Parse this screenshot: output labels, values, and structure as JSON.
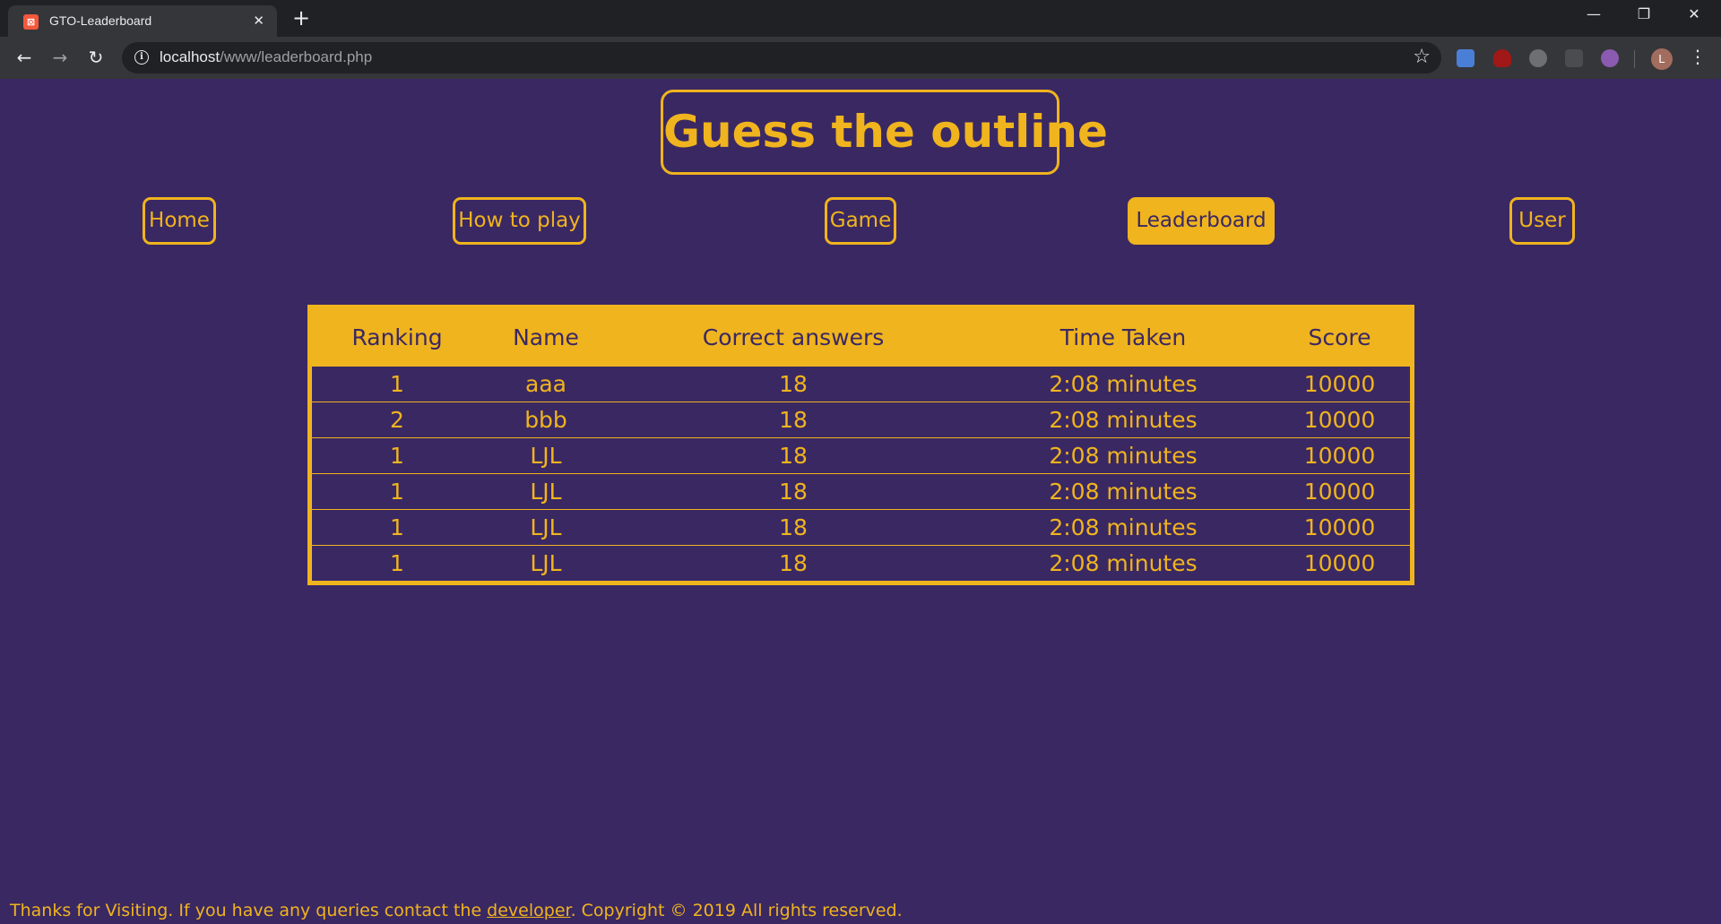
{
  "browser": {
    "tab_title": "GTO-Leaderboard",
    "favicon_letter": "",
    "close_glyph": "✕",
    "new_tab_glyph": "+",
    "url_host": "localhost",
    "url_path": "/www/leaderboard.php",
    "profile_initial": "L",
    "minimize_glyph": "—",
    "restore_glyph": "❐",
    "window_close_glyph": "✕",
    "back_glyph": "←",
    "forward_glyph": "→",
    "reload_glyph": "↻",
    "star_glyph": "☆",
    "menu_glyph": "⋮",
    "info_glyph": "i",
    "icons": [
      "back-icon",
      "forward-icon",
      "reload-icon",
      "info-icon",
      "star-icon",
      "google-translate-icon",
      "ublock-icon",
      "extension-icon",
      "extension-icon",
      "extension-icon",
      "profile-avatar",
      "menu-icon"
    ]
  },
  "page": {
    "title": "Guess the outline",
    "nav": {
      "home": "Home",
      "how_to_play": "How to play",
      "game": "Game",
      "leaderboard": "Leaderboard",
      "user": "User"
    },
    "active_nav": "leaderboard",
    "table": {
      "headers": {
        "ranking": "Ranking",
        "name": "Name",
        "correct": "Correct answers",
        "time": "Time Taken",
        "score": "Score"
      },
      "rows": [
        {
          "ranking": "1",
          "name": "aaa",
          "correct": "18",
          "time": "2:08 minutes",
          "score": "10000"
        },
        {
          "ranking": "2",
          "name": "bbb",
          "correct": "18",
          "time": "2:08 minutes",
          "score": "10000"
        },
        {
          "ranking": "1",
          "name": "LJL",
          "correct": "18",
          "time": "2:08 minutes",
          "score": "10000"
        },
        {
          "ranking": "1",
          "name": "LJL",
          "correct": "18",
          "time": "2:08 minutes",
          "score": "10000"
        },
        {
          "ranking": "1",
          "name": "LJL",
          "correct": "18",
          "time": "2:08 minutes",
          "score": "10000"
        },
        {
          "ranking": "1",
          "name": "LJL",
          "correct": "18",
          "time": "2:08 minutes",
          "score": "10000"
        }
      ]
    },
    "footer": {
      "before": "Thanks for Visiting. If you have any queries contact the ",
      "link": "developer",
      "after": ". Copyright © 2019 All rights reserved."
    }
  },
  "colors": {
    "background": "#3a2863",
    "accent": "#f0b41e"
  }
}
